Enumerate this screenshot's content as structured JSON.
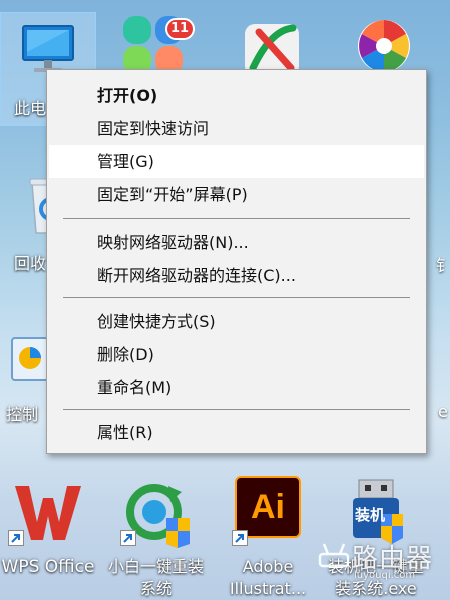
{
  "desktop": {
    "icons_top": [
      {
        "label": "此电脑",
        "visible_label": "此电"
      },
      {
        "label": ""
      },
      {
        "label": ""
      },
      {
        "label": ""
      }
    ],
    "recycle_bin": {
      "visible_label": "回收"
    },
    "control_panel": {
      "visible_label": "控制"
    },
    "right_edge_char_1": "钅",
    "right_edge_char_2": "e",
    "bottom_icons": [
      {
        "label_line1": "WPS Office",
        "label_line2": ""
      },
      {
        "label_line1": "小白一键重装",
        "label_line2": "系统"
      },
      {
        "label_line1": "Adobe",
        "label_line2": "Illustrat..."
      },
      {
        "label_line1": "装机吧一键重",
        "label_line2": "装系统.exe"
      }
    ],
    "qq_badge": "11",
    "ai_logo_text": "Ai",
    "usb_logo_text": "装机"
  },
  "context_menu": {
    "items": [
      {
        "label": "打开(O)"
      },
      {
        "label": "固定到快速访问"
      },
      {
        "label": "管理(G)"
      },
      {
        "label": "固定到“开始”屏幕(P)"
      },
      {
        "label": "映射网络驱动器(N)..."
      },
      {
        "label": "断开网络驱动器的连接(C)..."
      },
      {
        "label": "创建快捷方式(S)"
      },
      {
        "label": "删除(D)"
      },
      {
        "label": "重命名(M)"
      },
      {
        "label": "属性(R)"
      }
    ],
    "hovered": "管理(G)"
  },
  "watermark": {
    "text": "路由器",
    "subtext": "luyouqi.com"
  },
  "colors": {
    "menu_bg": "#f2f2f2",
    "menu_hover": "#ffffff",
    "separator": "#8f8f8f",
    "wps_red": "#d9362b",
    "ai_orange": "#ff9a00",
    "ai_bg": "#330000"
  }
}
